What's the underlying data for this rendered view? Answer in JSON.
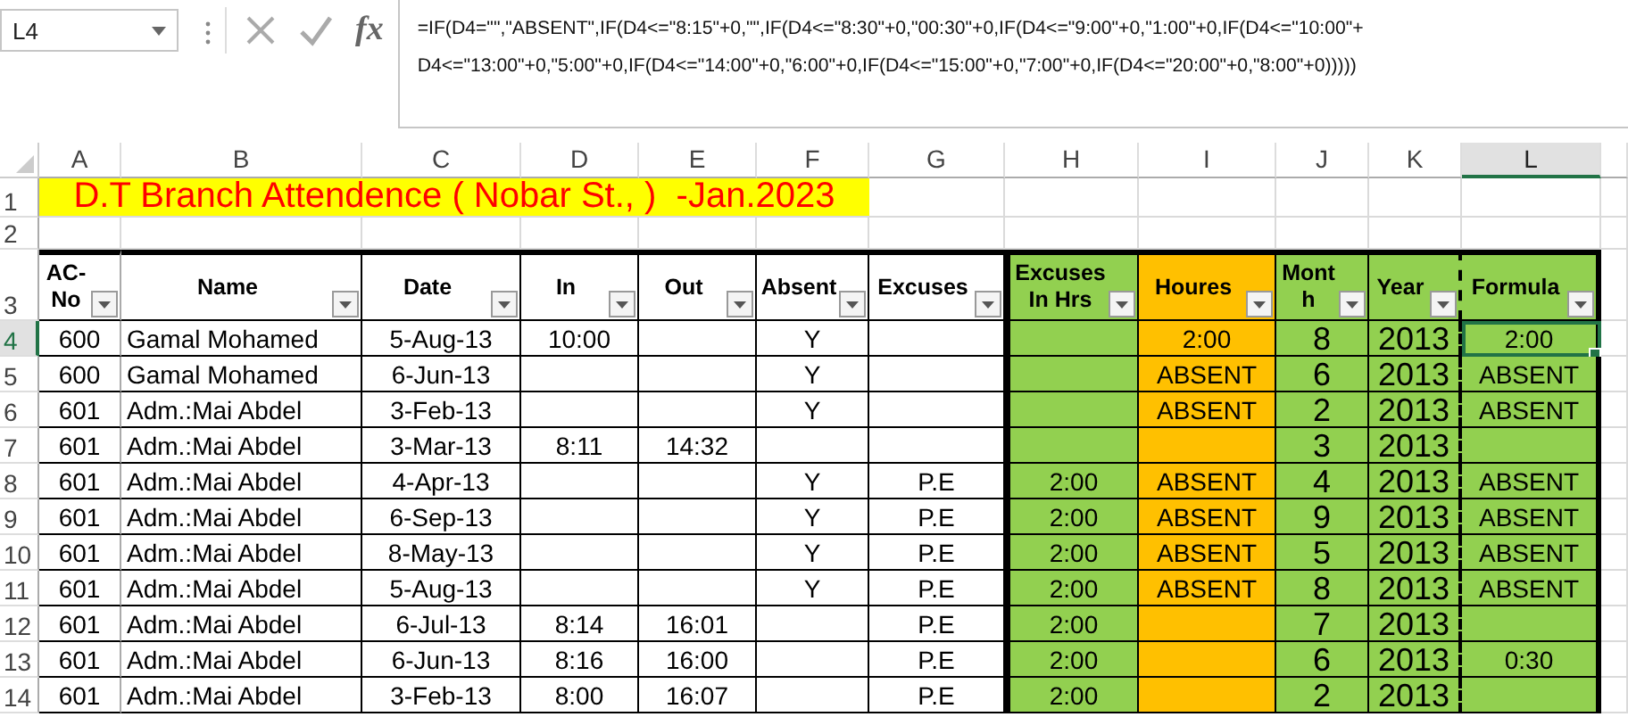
{
  "name_box": "L4",
  "formula_bar": {
    "function_label": "fx",
    "formula_lines": [
      "=IF(D4=\"\",\"ABSENT\",IF(D4<=\"8:15\"+0,\"\",IF(D4<=\"8:30\"+0,\"00:30\"+0,IF(D4<=\"9:00\"+0,\"1:00\"+0,IF(D4<=\"10:00\"+",
      "D4<=\"13:00\"+0,\"5:00\"+0,IF(D4<=\"14:00\"+0,\"6:00\"+0,IF(D4<=\"15:00\"+0,\"7:00\"+0,IF(D4<=\"20:00\"+0,\"8:00\"+0)))))"
    ]
  },
  "column_headers": [
    {
      "label": "A",
      "selected": false
    },
    {
      "label": "B",
      "selected": false
    },
    {
      "label": "C",
      "selected": false
    },
    {
      "label": "D",
      "selected": false
    },
    {
      "label": "E",
      "selected": false
    },
    {
      "label": "F",
      "selected": false
    },
    {
      "label": "G",
      "selected": false
    },
    {
      "label": "H",
      "selected": false
    },
    {
      "label": "I",
      "selected": false
    },
    {
      "label": "J",
      "selected": false
    },
    {
      "label": "K",
      "selected": false
    },
    {
      "label": "L",
      "selected": true
    }
  ],
  "row_headers": [
    {
      "label": "1",
      "selected": false
    },
    {
      "label": "2",
      "selected": false
    },
    {
      "label": "3",
      "selected": false
    },
    {
      "label": "4",
      "selected": true
    },
    {
      "label": "5",
      "selected": false
    },
    {
      "label": "6",
      "selected": false
    },
    {
      "label": "7",
      "selected": false
    },
    {
      "label": "8",
      "selected": false
    },
    {
      "label": "9",
      "selected": false
    },
    {
      "label": "10",
      "selected": false
    },
    {
      "label": "11",
      "selected": false
    },
    {
      "label": "12",
      "selected": false
    },
    {
      "label": "13",
      "selected": false
    },
    {
      "label": "14",
      "selected": false
    }
  ],
  "title": "D.T Branch Attendence ( Nobar St., )  -Jan.2023",
  "table": {
    "columns": [
      {
        "label": "AC-No"
      },
      {
        "label": "Name"
      },
      {
        "label": "Date"
      },
      {
        "label": "In"
      },
      {
        "label": "Out"
      },
      {
        "label": "Absent"
      },
      {
        "label": "Excuses"
      },
      {
        "label": "Excuses In Hrs",
        "color": "#92d050"
      },
      {
        "label": "Houres",
        "color": "#ffc000"
      },
      {
        "label": "Month",
        "color": "#92d050"
      },
      {
        "label": "Year",
        "color": "#92d050"
      },
      {
        "label": "Formula",
        "color": "#92d050"
      }
    ],
    "rows": [
      [
        "600",
        "Gamal Mohamed",
        "5-Aug-13",
        "10:00",
        null,
        "Y",
        null,
        null,
        "2:00",
        "8",
        "2013",
        "2:00"
      ],
      [
        "600",
        "Gamal Mohamed",
        "6-Jun-13",
        null,
        null,
        "Y",
        null,
        null,
        "ABSENT",
        "6",
        "2013",
        "ABSENT"
      ],
      [
        "601",
        "Adm.:Mai Abdel",
        "3-Feb-13",
        null,
        null,
        "Y",
        null,
        null,
        "ABSENT",
        "2",
        "2013",
        "ABSENT"
      ],
      [
        "601",
        "Adm.:Mai Abdel",
        "3-Mar-13",
        "8:11",
        "14:32",
        null,
        null,
        null,
        null,
        "3",
        "2013",
        null
      ],
      [
        "601",
        "Adm.:Mai Abdel",
        "4-Apr-13",
        null,
        null,
        "Y",
        "P.E",
        "2:00",
        "ABSENT",
        "4",
        "2013",
        "ABSENT"
      ],
      [
        "601",
        "Adm.:Mai Abdel",
        "6-Sep-13",
        null,
        null,
        "Y",
        "P.E",
        "2:00",
        "ABSENT",
        "9",
        "2013",
        "ABSENT"
      ],
      [
        "601",
        "Adm.:Mai Abdel",
        "8-May-13",
        null,
        null,
        "Y",
        "P.E",
        "2:00",
        "ABSENT",
        "5",
        "2013",
        "ABSENT"
      ],
      [
        "601",
        "Adm.:Mai Abdel",
        "5-Aug-13",
        null,
        null,
        "Y",
        "P.E",
        "2:00",
        "ABSENT",
        "8",
        "2013",
        "ABSENT"
      ],
      [
        "601",
        "Adm.:Mai Abdel",
        "6-Jul-13",
        "8:14",
        "16:01",
        null,
        "P.E",
        "2:00",
        null,
        "7",
        "2013",
        null
      ],
      [
        "601",
        "Adm.:Mai Abdel",
        "6-Jun-13",
        "8:16",
        "16:00",
        null,
        "P.E",
        "2:00",
        null,
        "6",
        "2013",
        "0:30"
      ],
      [
        "601",
        "Adm.:Mai Abdel",
        "3-Feb-13",
        "8:00",
        "16:07",
        null,
        "P.E",
        "2:00",
        null,
        "2",
        "2013",
        null
      ]
    ]
  }
}
